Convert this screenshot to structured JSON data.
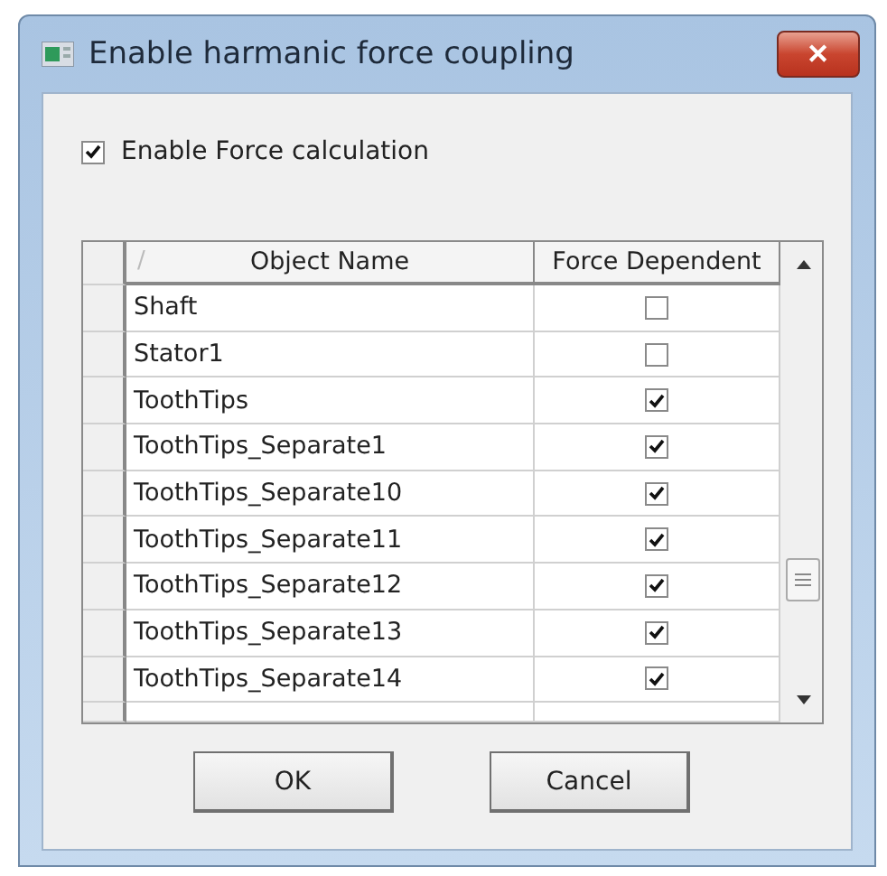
{
  "window": {
    "title": "Enable harmanic force coupling",
    "close": "✕"
  },
  "enable_force": {
    "label": "Enable Force calculation",
    "checked": true
  },
  "table": {
    "sort_mark": "/",
    "columns": [
      "Object Name",
      "Force Dependent"
    ],
    "rows": [
      {
        "name": "Shaft",
        "checked": false
      },
      {
        "name": "Stator1",
        "checked": false
      },
      {
        "name": "ToothTips",
        "checked": true
      },
      {
        "name": "ToothTips_Separate1",
        "checked": true
      },
      {
        "name": "ToothTips_Separate10",
        "checked": true
      },
      {
        "name": "ToothTips_Separate11",
        "checked": true
      },
      {
        "name": "ToothTips_Separate12",
        "checked": true
      },
      {
        "name": "ToothTips_Separate13",
        "checked": true
      },
      {
        "name": "ToothTips_Separate14",
        "checked": true
      }
    ]
  },
  "buttons": [
    "OK",
    "Cancel"
  ]
}
